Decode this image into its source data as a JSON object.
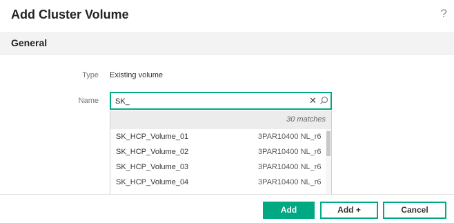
{
  "dialog": {
    "title": "Add Cluster Volume",
    "help_glyph": "?"
  },
  "section": {
    "title": "General"
  },
  "form": {
    "type_label": "Type",
    "type_value": "Existing volume",
    "name_label": "Name",
    "name_value": "SK_",
    "clear_glyph": "✕"
  },
  "dropdown": {
    "matches_text": "30 matches",
    "options": [
      {
        "name": "SK_HCP_Volume_01",
        "type": "3PAR10400 NL_r6"
      },
      {
        "name": "SK_HCP_Volume_02",
        "type": "3PAR10400 NL_r6"
      },
      {
        "name": "SK_HCP_Volume_03",
        "type": "3PAR10400 NL_r6"
      },
      {
        "name": "SK_HCP_Volume_04",
        "type": "3PAR10400 NL_r6"
      }
    ]
  },
  "footer": {
    "add_label": "Add",
    "add_plus_label": "Add +",
    "cancel_label": "Cancel"
  },
  "colors": {
    "accent": "#01a982",
    "section_bg": "#f3f3f3",
    "matches_bg": "#ececec"
  },
  "icons": {
    "help": "help-icon",
    "clear": "clear-icon",
    "search": "search-icon"
  }
}
